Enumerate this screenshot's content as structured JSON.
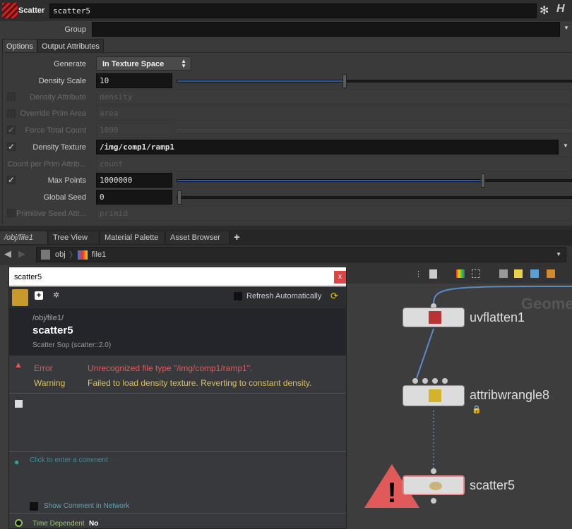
{
  "header": {
    "node_type": "Scatter",
    "node_name": "scatter5"
  },
  "group": {
    "label": "Group",
    "value": ""
  },
  "tabs": [
    "Options",
    "Output Attributes"
  ],
  "params": {
    "generate": {
      "label": "Generate",
      "value": "In Texture Space"
    },
    "density_scale": {
      "label": "Density Scale",
      "value": "10",
      "slider": 0.3
    },
    "density_attribute": {
      "label": "Density Attribute",
      "value": "density"
    },
    "override_prim_area": {
      "label": "Override Prim Area",
      "value": "area"
    },
    "force_total_count": {
      "label": "Force Total Count",
      "value": "1000",
      "checked": true
    },
    "density_texture": {
      "label": "Density Texture",
      "value": "/img/comp1/ramp1",
      "checked": true
    },
    "count_per_prim": {
      "label": "Count per Prim Attrib...",
      "value": "count"
    },
    "max_points": {
      "label": "Max Points",
      "value": "1000000",
      "checked": true
    },
    "global_seed": {
      "label": "Global Seed",
      "value": "0"
    },
    "prim_seed": {
      "label": "Primitive Seed Attr...",
      "value": "primid"
    }
  },
  "pane_tabs": [
    "/obj/file1",
    "Tree View",
    "Material Palette",
    "Asset Browser"
  ],
  "path": {
    "root": "obj",
    "current": "file1"
  },
  "info": {
    "title": "scatter5",
    "refresh_label": "Refresh Automatically",
    "path": "/obj/file1/",
    "name": "scatter5",
    "type": "Scatter Sop (scatter::2.0)",
    "error_label": "Error",
    "error_text": "Unrecognized file type \"/img/comp1/ramp1\".",
    "warning_label": "Warning",
    "warning_text": "Failed to load density texture. Reverting to constant density.",
    "comment_placeholder": "Click to enter a comment",
    "show_comment": "Show Comment in Network",
    "time_dep_label": "Time Dependent",
    "time_dep_value": "No",
    "close": "x"
  },
  "network": {
    "context": "Geome",
    "nodes": [
      "uvflatten1",
      "attribwrangle8",
      "scatter5"
    ]
  },
  "colors": {
    "error": "#e05a5a",
    "warning": "#d8c060",
    "accent": "#2d5aa0"
  }
}
